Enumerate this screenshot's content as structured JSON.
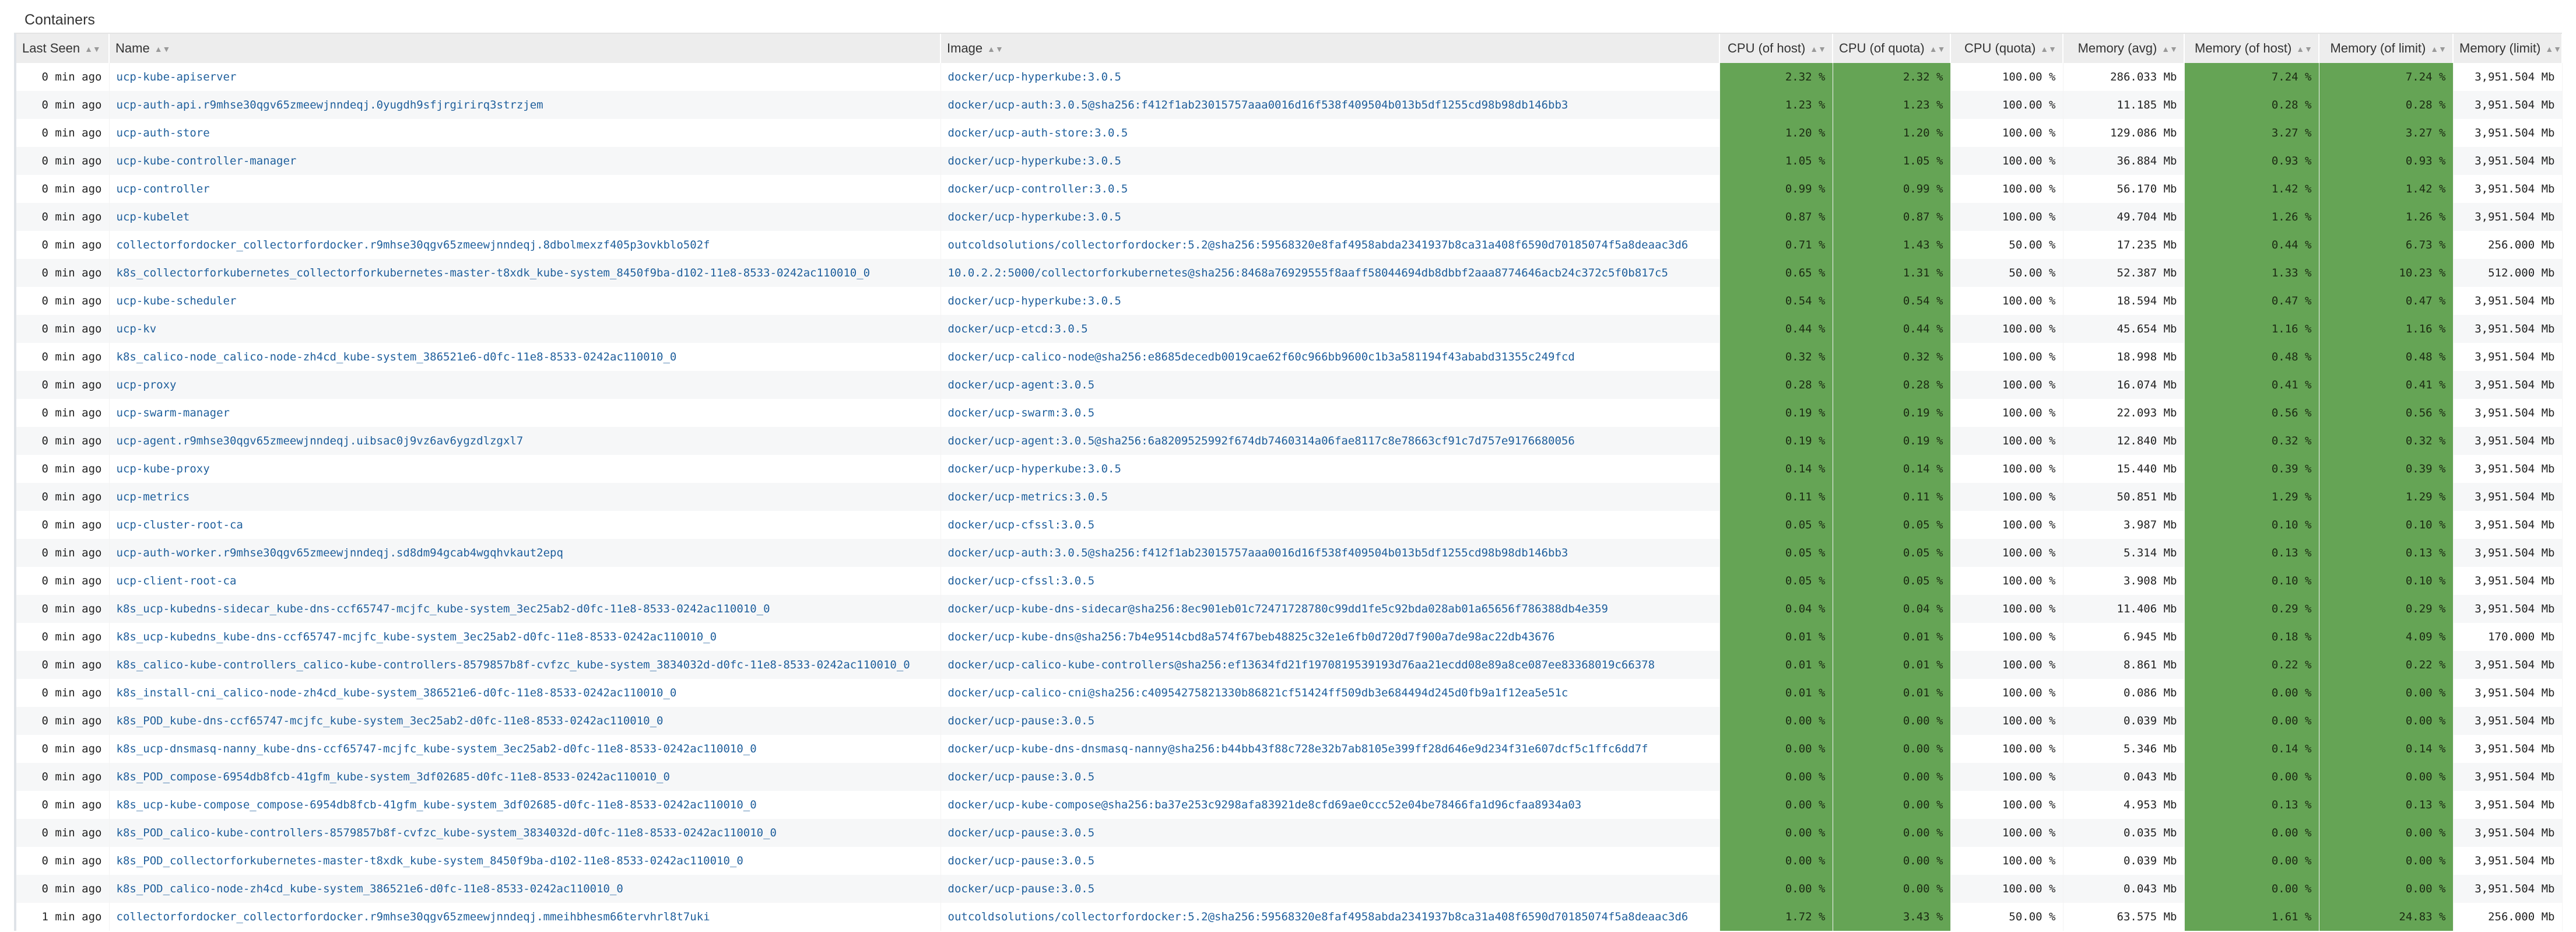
{
  "panel": {
    "title": "Containers"
  },
  "columns": [
    {
      "key": "last_seen",
      "label": "Last Seen",
      "align": "left"
    },
    {
      "key": "name",
      "label": "Name",
      "align": "left"
    },
    {
      "key": "image",
      "label": "Image",
      "align": "left"
    },
    {
      "key": "cpu_host",
      "label": "CPU (of host)",
      "align": "right"
    },
    {
      "key": "cpu_quota",
      "label": "CPU (of quota)",
      "align": "right"
    },
    {
      "key": "cpu_quota_pct",
      "label": "CPU (quota)",
      "align": "right"
    },
    {
      "key": "mem_avg",
      "label": "Memory (avg)",
      "align": "right"
    },
    {
      "key": "mem_host",
      "label": "Memory (of host)",
      "align": "right"
    },
    {
      "key": "mem_limit_pct",
      "label": "Memory (of limit)",
      "align": "right"
    },
    {
      "key": "mem_limit",
      "label": "Memory (limit)",
      "align": "right"
    }
  ],
  "highlight_color": "#65a455",
  "link_color": "#1f5f9c",
  "rows": [
    [
      "0 min ago",
      "ucp-kube-apiserver",
      "docker/ucp-hyperkube:3.0.5",
      "2.32 %",
      "2.32 %",
      "100.00 %",
      "286.033 Mb",
      "7.24 %",
      "7.24 %",
      "3,951.504 Mb"
    ],
    [
      "0 min ago",
      "ucp-auth-api.r9mhse30qgv65zmeewjnndeqj.0yugdh9sfjrgirirq3strzjem",
      "docker/ucp-auth:3.0.5@sha256:f412f1ab23015757aaa0016d16f538f409504b013b5df1255cd98b98db146bb3",
      "1.23 %",
      "1.23 %",
      "100.00 %",
      "11.185 Mb",
      "0.28 %",
      "0.28 %",
      "3,951.504 Mb"
    ],
    [
      "0 min ago",
      "ucp-auth-store",
      "docker/ucp-auth-store:3.0.5",
      "1.20 %",
      "1.20 %",
      "100.00 %",
      "129.086 Mb",
      "3.27 %",
      "3.27 %",
      "3,951.504 Mb"
    ],
    [
      "0 min ago",
      "ucp-kube-controller-manager",
      "docker/ucp-hyperkube:3.0.5",
      "1.05 %",
      "1.05 %",
      "100.00 %",
      "36.884 Mb",
      "0.93 %",
      "0.93 %",
      "3,951.504 Mb"
    ],
    [
      "0 min ago",
      "ucp-controller",
      "docker/ucp-controller:3.0.5",
      "0.99 %",
      "0.99 %",
      "100.00 %",
      "56.170 Mb",
      "1.42 %",
      "1.42 %",
      "3,951.504 Mb"
    ],
    [
      "0 min ago",
      "ucp-kubelet",
      "docker/ucp-hyperkube:3.0.5",
      "0.87 %",
      "0.87 %",
      "100.00 %",
      "49.704 Mb",
      "1.26 %",
      "1.26 %",
      "3,951.504 Mb"
    ],
    [
      "0 min ago",
      "collectorfordocker_collectorfordocker.r9mhse30qgv65zmeewjnndeqj.8dbolmexzf405p3ovkblo502f",
      "outcoldsolutions/collectorfordocker:5.2@sha256:59568320e8faf4958abda2341937b8ca31a408f6590d70185074f5a8deaac3d6",
      "0.71 %",
      "1.43 %",
      "50.00 %",
      "17.235 Mb",
      "0.44 %",
      "6.73 %",
      "256.000 Mb"
    ],
    [
      "0 min ago",
      "k8s_collectorforkubernetes_collectorforkubernetes-master-t8xdk_kube-system_8450f9ba-d102-11e8-8533-0242ac110010_0",
      "10.0.2.2:5000/collectorforkubernetes@sha256:8468a76929555f8aaff58044694db8dbbf2aaa8774646acb24c372c5f0b817c5",
      "0.65 %",
      "1.31 %",
      "50.00 %",
      "52.387 Mb",
      "1.33 %",
      "10.23 %",
      "512.000 Mb"
    ],
    [
      "0 min ago",
      "ucp-kube-scheduler",
      "docker/ucp-hyperkube:3.0.5",
      "0.54 %",
      "0.54 %",
      "100.00 %",
      "18.594 Mb",
      "0.47 %",
      "0.47 %",
      "3,951.504 Mb"
    ],
    [
      "0 min ago",
      "ucp-kv",
      "docker/ucp-etcd:3.0.5",
      "0.44 %",
      "0.44 %",
      "100.00 %",
      "45.654 Mb",
      "1.16 %",
      "1.16 %",
      "3,951.504 Mb"
    ],
    [
      "0 min ago",
      "k8s_calico-node_calico-node-zh4cd_kube-system_386521e6-d0fc-11e8-8533-0242ac110010_0",
      "docker/ucp-calico-node@sha256:e8685decedb0019cae62f60c966bb9600c1b3a581194f43ababd31355c249fcd",
      "0.32 %",
      "0.32 %",
      "100.00 %",
      "18.998 Mb",
      "0.48 %",
      "0.48 %",
      "3,951.504 Mb"
    ],
    [
      "0 min ago",
      "ucp-proxy",
      "docker/ucp-agent:3.0.5",
      "0.28 %",
      "0.28 %",
      "100.00 %",
      "16.074 Mb",
      "0.41 %",
      "0.41 %",
      "3,951.504 Mb"
    ],
    [
      "0 min ago",
      "ucp-swarm-manager",
      "docker/ucp-swarm:3.0.5",
      "0.19 %",
      "0.19 %",
      "100.00 %",
      "22.093 Mb",
      "0.56 %",
      "0.56 %",
      "3,951.504 Mb"
    ],
    [
      "0 min ago",
      "ucp-agent.r9mhse30qgv65zmeewjnndeqj.uibsac0j9vz6av6ygzdlzgxl7",
      "docker/ucp-agent:3.0.5@sha256:6a8209525992f674db7460314a06fae8117c8e78663cf91c7d757e9176680056",
      "0.19 %",
      "0.19 %",
      "100.00 %",
      "12.840 Mb",
      "0.32 %",
      "0.32 %",
      "3,951.504 Mb"
    ],
    [
      "0 min ago",
      "ucp-kube-proxy",
      "docker/ucp-hyperkube:3.0.5",
      "0.14 %",
      "0.14 %",
      "100.00 %",
      "15.440 Mb",
      "0.39 %",
      "0.39 %",
      "3,951.504 Mb"
    ],
    [
      "0 min ago",
      "ucp-metrics",
      "docker/ucp-metrics:3.0.5",
      "0.11 %",
      "0.11 %",
      "100.00 %",
      "50.851 Mb",
      "1.29 %",
      "1.29 %",
      "3,951.504 Mb"
    ],
    [
      "0 min ago",
      "ucp-cluster-root-ca",
      "docker/ucp-cfssl:3.0.5",
      "0.05 %",
      "0.05 %",
      "100.00 %",
      "3.987 Mb",
      "0.10 %",
      "0.10 %",
      "3,951.504 Mb"
    ],
    [
      "0 min ago",
      "ucp-auth-worker.r9mhse30qgv65zmeewjnndeqj.sd8dm94gcab4wgqhvkaut2epq",
      "docker/ucp-auth:3.0.5@sha256:f412f1ab23015757aaa0016d16f538f409504b013b5df1255cd98b98db146bb3",
      "0.05 %",
      "0.05 %",
      "100.00 %",
      "5.314 Mb",
      "0.13 %",
      "0.13 %",
      "3,951.504 Mb"
    ],
    [
      "0 min ago",
      "ucp-client-root-ca",
      "docker/ucp-cfssl:3.0.5",
      "0.05 %",
      "0.05 %",
      "100.00 %",
      "3.908 Mb",
      "0.10 %",
      "0.10 %",
      "3,951.504 Mb"
    ],
    [
      "0 min ago",
      "k8s_ucp-kubedns-sidecar_kube-dns-ccf65747-mcjfc_kube-system_3ec25ab2-d0fc-11e8-8533-0242ac110010_0",
      "docker/ucp-kube-dns-sidecar@sha256:8ec901eb01c72471728780c99dd1fe5c92bda028ab01a65656f786388db4e359",
      "0.04 %",
      "0.04 %",
      "100.00 %",
      "11.406 Mb",
      "0.29 %",
      "0.29 %",
      "3,951.504 Mb"
    ],
    [
      "0 min ago",
      "k8s_ucp-kubedns_kube-dns-ccf65747-mcjfc_kube-system_3ec25ab2-d0fc-11e8-8533-0242ac110010_0",
      "docker/ucp-kube-dns@sha256:7b4e9514cbd8a574f67beb48825c32e1e6fb0d720d7f900a7de98ac22db43676",
      "0.01 %",
      "0.01 %",
      "100.00 %",
      "6.945 Mb",
      "0.18 %",
      "4.09 %",
      "170.000 Mb"
    ],
    [
      "0 min ago",
      "k8s_calico-kube-controllers_calico-kube-controllers-8579857b8f-cvfzc_kube-system_3834032d-d0fc-11e8-8533-0242ac110010_0",
      "docker/ucp-calico-kube-controllers@sha256:ef13634fd21f1970819539193d76aa21ecdd08e89a8ce087ee83368019c66378",
      "0.01 %",
      "0.01 %",
      "100.00 %",
      "8.861 Mb",
      "0.22 %",
      "0.22 %",
      "3,951.504 Mb"
    ],
    [
      "0 min ago",
      "k8s_install-cni_calico-node-zh4cd_kube-system_386521e6-d0fc-11e8-8533-0242ac110010_0",
      "docker/ucp-calico-cni@sha256:c40954275821330b86821cf51424ff509db3e684494d245d0fb9a1f12ea5e51c",
      "0.01 %",
      "0.01 %",
      "100.00 %",
      "0.086 Mb",
      "0.00 %",
      "0.00 %",
      "3,951.504 Mb"
    ],
    [
      "0 min ago",
      "k8s_POD_kube-dns-ccf65747-mcjfc_kube-system_3ec25ab2-d0fc-11e8-8533-0242ac110010_0",
      "docker/ucp-pause:3.0.5",
      "0.00 %",
      "0.00 %",
      "100.00 %",
      "0.039 Mb",
      "0.00 %",
      "0.00 %",
      "3,951.504 Mb"
    ],
    [
      "0 min ago",
      "k8s_ucp-dnsmasq-nanny_kube-dns-ccf65747-mcjfc_kube-system_3ec25ab2-d0fc-11e8-8533-0242ac110010_0",
      "docker/ucp-kube-dns-dnsmasq-nanny@sha256:b44bb43f88c728e32b7ab8105e399ff28d646e9d234f31e607dcf5c1ffc6dd7f",
      "0.00 %",
      "0.00 %",
      "100.00 %",
      "5.346 Mb",
      "0.14 %",
      "0.14 %",
      "3,951.504 Mb"
    ],
    [
      "0 min ago",
      "k8s_POD_compose-6954db8fcb-41gfm_kube-system_3df02685-d0fc-11e8-8533-0242ac110010_0",
      "docker/ucp-pause:3.0.5",
      "0.00 %",
      "0.00 %",
      "100.00 %",
      "0.043 Mb",
      "0.00 %",
      "0.00 %",
      "3,951.504 Mb"
    ],
    [
      "0 min ago",
      "k8s_ucp-kube-compose_compose-6954db8fcb-41gfm_kube-system_3df02685-d0fc-11e8-8533-0242ac110010_0",
      "docker/ucp-kube-compose@sha256:ba37e253c9298afa83921de8cfd69ae0ccc52e04be78466fa1d96cfaa8934a03",
      "0.00 %",
      "0.00 %",
      "100.00 %",
      "4.953 Mb",
      "0.13 %",
      "0.13 %",
      "3,951.504 Mb"
    ],
    [
      "0 min ago",
      "k8s_POD_calico-kube-controllers-8579857b8f-cvfzc_kube-system_3834032d-d0fc-11e8-8533-0242ac110010_0",
      "docker/ucp-pause:3.0.5",
      "0.00 %",
      "0.00 %",
      "100.00 %",
      "0.035 Mb",
      "0.00 %",
      "0.00 %",
      "3,951.504 Mb"
    ],
    [
      "0 min ago",
      "k8s_POD_collectorforkubernetes-master-t8xdk_kube-system_8450f9ba-d102-11e8-8533-0242ac110010_0",
      "docker/ucp-pause:3.0.5",
      "0.00 %",
      "0.00 %",
      "100.00 %",
      "0.039 Mb",
      "0.00 %",
      "0.00 %",
      "3,951.504 Mb"
    ],
    [
      "0 min ago",
      "k8s_POD_calico-node-zh4cd_kube-system_386521e6-d0fc-11e8-8533-0242ac110010_0",
      "docker/ucp-pause:3.0.5",
      "0.00 %",
      "0.00 %",
      "100.00 %",
      "0.043 Mb",
      "0.00 %",
      "0.00 %",
      "3,951.504 Mb"
    ],
    [
      "1 min ago",
      "collectorfordocker_collectorfordocker.r9mhse30qgv65zmeewjnndeqj.mmeihbhesm66tervhrl8t7uki",
      "outcoldsolutions/collectorfordocker:5.2@sha256:59568320e8faf4958abda2341937b8ca31a408f6590d70185074f5a8deaac3d6",
      "1.72 %",
      "3.43 %",
      "50.00 %",
      "63.575 Mb",
      "1.61 %",
      "24.83 %",
      "256.000 Mb"
    ]
  ]
}
